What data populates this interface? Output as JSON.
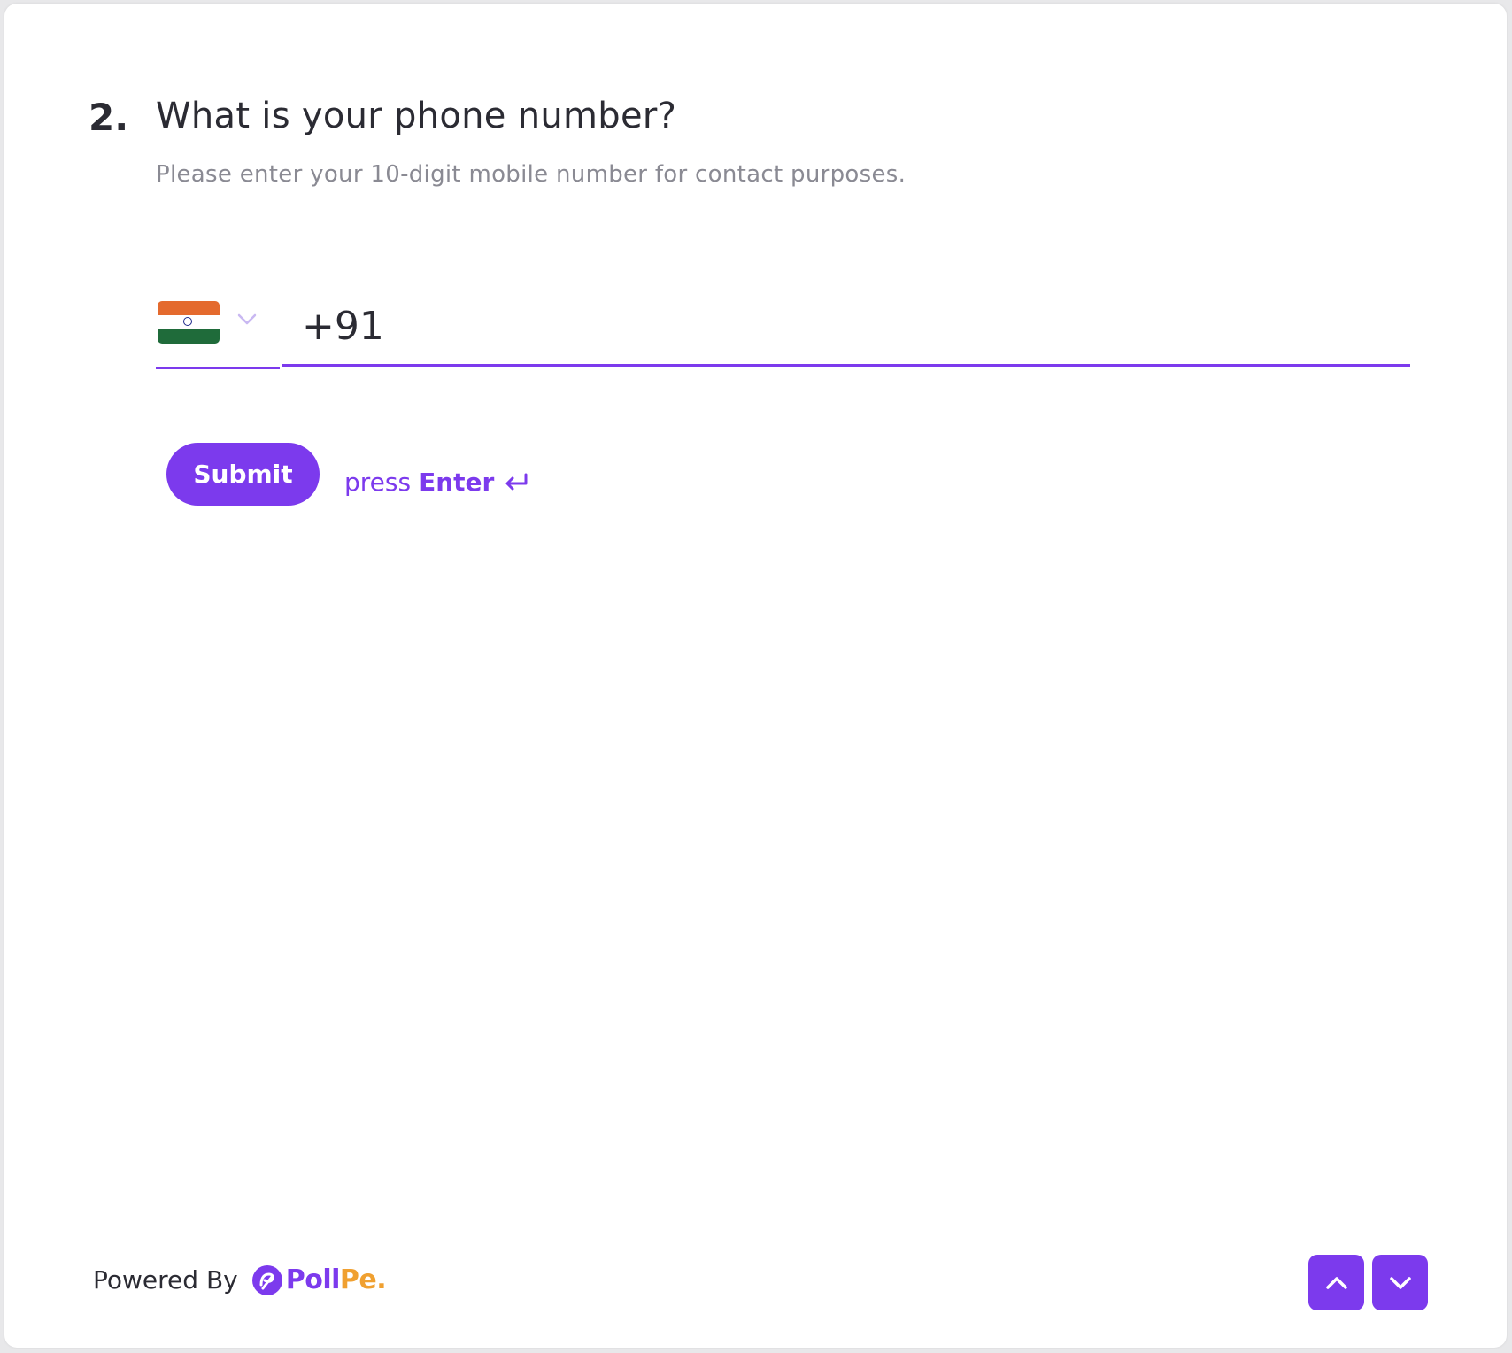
{
  "question": {
    "number": "2.",
    "title": "What is your phone number?",
    "description": "Please enter your 10-digit mobile number for contact purposes."
  },
  "phone": {
    "country_flag": "india-flag-icon",
    "value": "+91"
  },
  "actions": {
    "submit_label": "Submit",
    "hint_press": "press",
    "hint_key": "Enter"
  },
  "footer": {
    "powered_by": "Powered By",
    "brand_part1": "Poll",
    "brand_part2": "Pe."
  },
  "colors": {
    "accent": "#7c3aed",
    "brand_orange": "#f0a030",
    "text": "#2b2b33",
    "muted": "#8a8a93"
  }
}
